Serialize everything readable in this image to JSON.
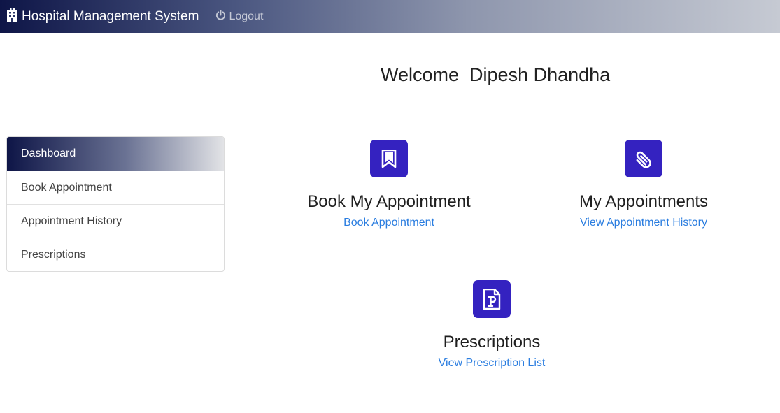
{
  "navbar": {
    "brand_icon": "hospital-icon",
    "brand": "Hospital Management System",
    "logout_icon": "power-icon",
    "logout": "Logout"
  },
  "welcome": {
    "text": "Welcome  Dipesh Dhandha"
  },
  "sidebar": {
    "items": [
      {
        "label": "Dashboard",
        "active": true
      },
      {
        "label": "Book Appointment",
        "active": false
      },
      {
        "label": "Appointment History",
        "active": false
      },
      {
        "label": "Prescriptions",
        "active": false
      }
    ]
  },
  "cards": [
    {
      "icon": "bookmark-icon",
      "title": "Book My Appointment",
      "link": "Book Appointment"
    },
    {
      "icon": "paperclip-icon",
      "title": "My Appointments",
      "link": "View Appointment History"
    },
    {
      "icon": "prescription-file-icon",
      "title": "Prescriptions",
      "link": "View Prescription List"
    }
  ],
  "colors": {
    "accent": "#3422c0",
    "link": "#2a7de0",
    "navbar_dark": "#0e1547"
  }
}
